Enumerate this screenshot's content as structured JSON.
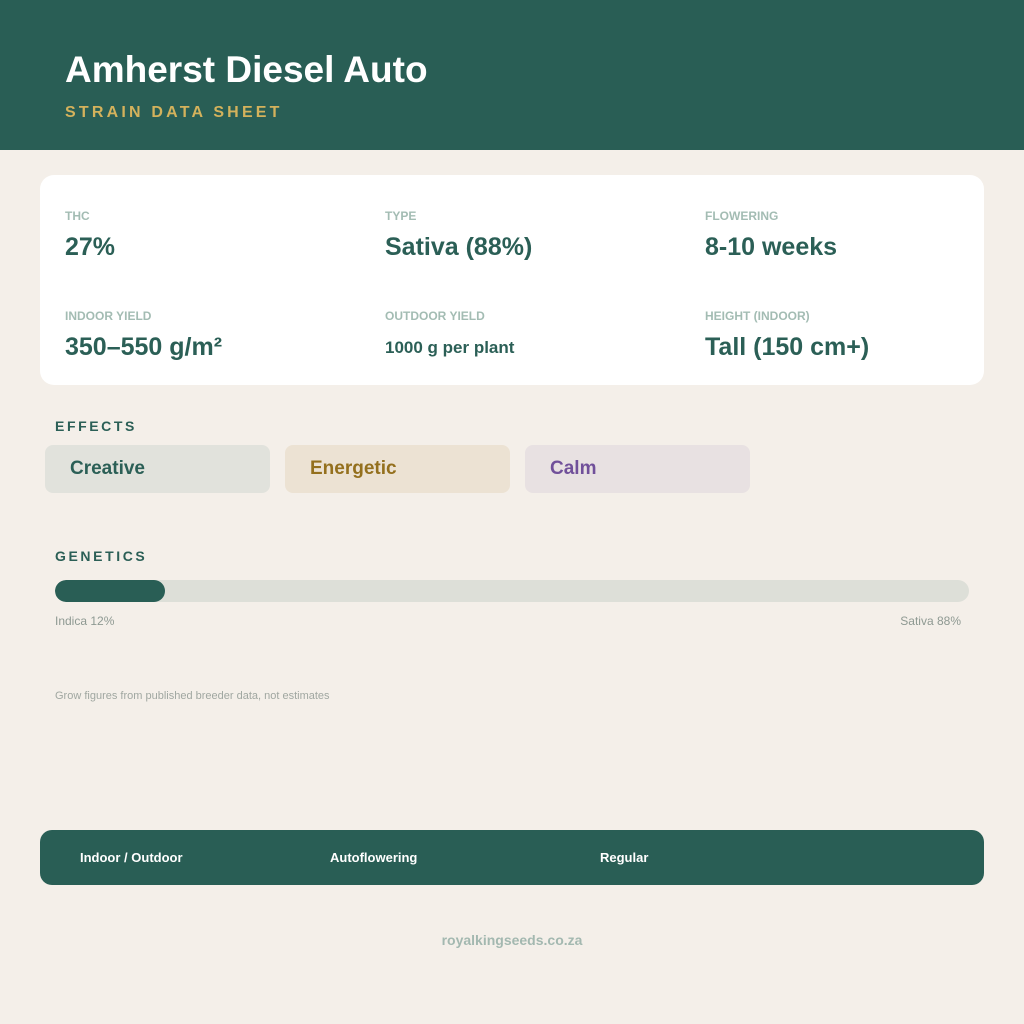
{
  "header": {
    "title": "Amherst Diesel Auto",
    "subtitle": "STRAIN DATA SHEET"
  },
  "stats": {
    "thc": {
      "label": "THC",
      "value": "27%"
    },
    "type": {
      "label": "TYPE",
      "value": "Sativa (88%)"
    },
    "flowering": {
      "label": "FLOWERING",
      "value": "8-10 weeks"
    },
    "indoor_yield": {
      "label": "INDOOR YIELD",
      "value": "350–550 g/m²"
    },
    "outdoor_yield": {
      "label": "OUTDOOR YIELD",
      "value": "1000 g per plant"
    },
    "height": {
      "label": "HEIGHT (INDOOR)",
      "value": "Tall (150 cm+)"
    }
  },
  "effects": {
    "heading": "EFFECTS",
    "items": [
      "Creative",
      "Energetic",
      "Calm"
    ]
  },
  "genetics": {
    "heading": "GENETICS",
    "indica_percent": 12,
    "sativa_percent": 88,
    "indica_label": "Indica 12%",
    "sativa_label": "Sativa 88%"
  },
  "note": "Grow figures from published breeder data, not estimates",
  "footer": {
    "tags": [
      "Indoor / Outdoor",
      "Autoflowering",
      "Regular"
    ]
  },
  "website": "royalkingseeds.co.za",
  "colors": {
    "primary": "#295e55",
    "accent_gold": "#d4b25c",
    "background": "#f4efe9",
    "effect_creative": "#2b5f56",
    "effect_energetic": "#94701e",
    "effect_calm": "#71509a"
  }
}
